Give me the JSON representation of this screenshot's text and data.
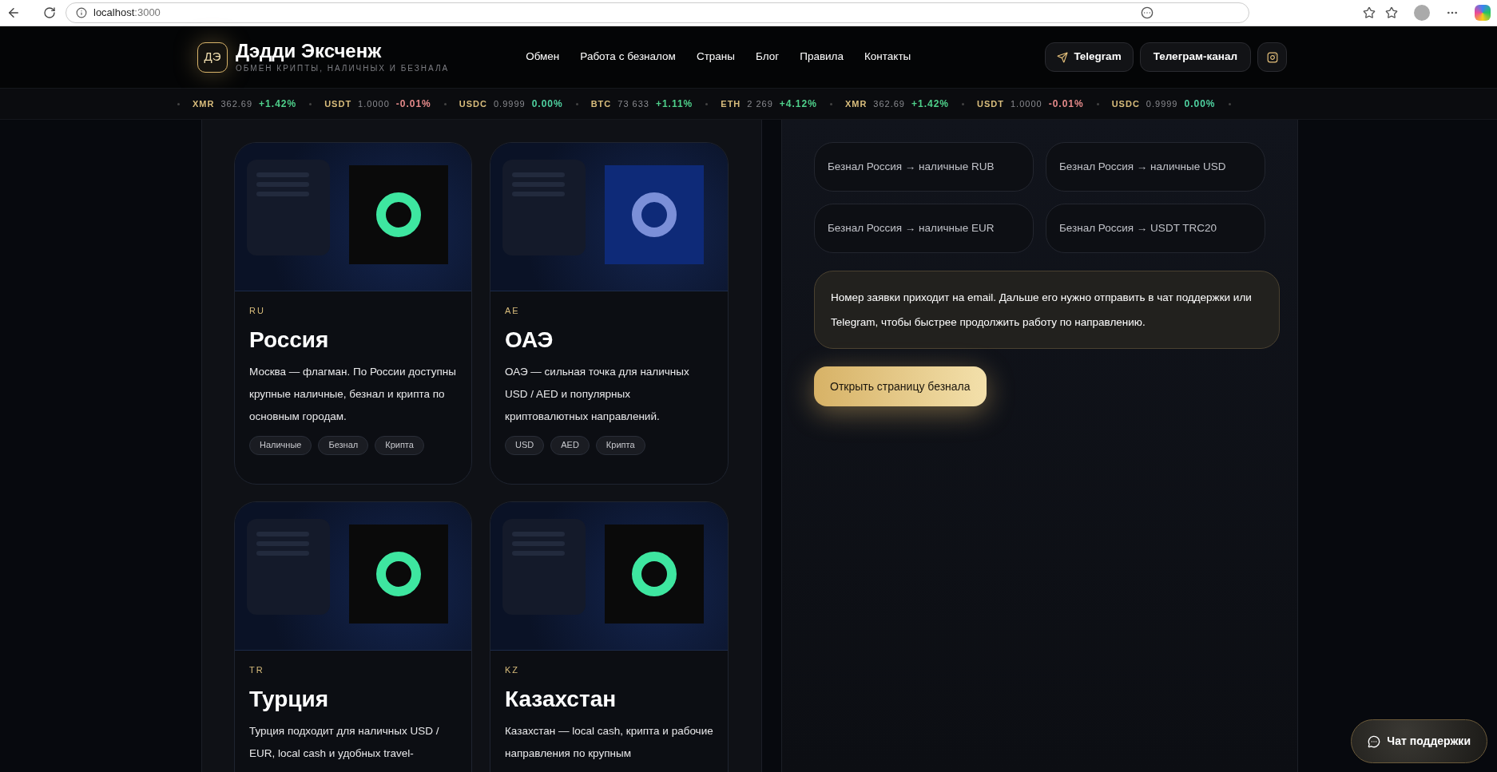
{
  "browser": {
    "url_host": "localhost",
    "url_port": ":3000"
  },
  "header": {
    "logo_mark": "ДЭ",
    "brand": "Дэдди Эксченж",
    "tagline": "ОБМЕН КРИПТЫ, НАЛИЧНЫХ И БЕЗНАЛА",
    "nav": [
      "Обмен",
      "Работа с безналом",
      "Страны",
      "Блог",
      "Правила",
      "Контакты"
    ],
    "actions": [
      {
        "kind": "telegram",
        "label": "Telegram"
      },
      {
        "kind": "text",
        "label": "Телеграм-канал"
      },
      {
        "kind": "instagram"
      }
    ]
  },
  "ticker": [
    {
      "symbol": "XMR",
      "price": "362.69",
      "change": "+1.42%",
      "color": "#4fd18b"
    },
    {
      "symbol": "USDT",
      "price": "1.0000",
      "change": "-0.01%",
      "color": "#e58a8a"
    },
    {
      "symbol": "USDC",
      "price": "0.9999",
      "change": "0.00%",
      "color": "#4fd1a0"
    },
    {
      "symbol": "BTC",
      "price": "73 633",
      "change": "+1.11%",
      "color": "#4fd18b"
    },
    {
      "symbol": "ETH",
      "price": "2 269",
      "change": "+4.12%",
      "color": "#4fd18b"
    },
    {
      "symbol": "XMR",
      "price": "362.69",
      "change": "+1.42%",
      "color": "#4fd18b"
    },
    {
      "symbol": "USDT",
      "price": "1.0000",
      "change": "-0.01%",
      "color": "#e58a8a"
    },
    {
      "symbol": "USDC",
      "price": "0.9999",
      "change": "0.00%",
      "color": "#4fd1a0"
    }
  ],
  "countries": [
    {
      "code": "RU",
      "name": "Россия",
      "description": "Москва — флагман. По России доступны крупные наличные, безнал и крипта по основным городам.",
      "tags": [
        "Наличные",
        "Безнал",
        "Крипта"
      ]
    },
    {
      "code": "AE",
      "name": "ОАЭ",
      "description": "ОАЭ — сильная точка для наличных USD / AED и популярных криптовалютных направлений.",
      "tags": [
        "USD",
        "AED",
        "Крипта"
      ]
    },
    {
      "code": "TR",
      "name": "Турция",
      "description": "Турция подходит для наличных USD / EUR, local cash и удобных travel-"
    },
    {
      "code": "KZ",
      "name": "Казахстан",
      "description": "Казахстан — local cash, крипта и рабочие направления по крупным"
    }
  ],
  "directions": [
    "Безнал Россия → наличные RUB",
    "Безнал Россия → наличные USD",
    "Безнал Россия → наличные EUR",
    "Безнал Россия → USDT TRC20"
  ],
  "note": "Номер заявки приходит на email. Дальше его нужно отправить в чат поддержки или Telegram, чтобы быстрее продолжить работу по направлению.",
  "open_button": "Открыть страницу безнала",
  "chat_button": "Чат поддержки"
}
